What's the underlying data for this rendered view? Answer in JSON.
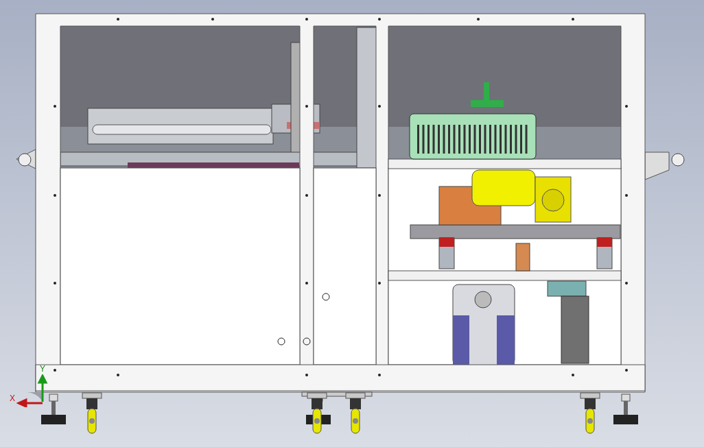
{
  "viewport": {
    "axis_labels": [
      {
        "kind": "y",
        "text": "Y"
      },
      {
        "kind": "x",
        "text": "X"
      }
    ]
  }
}
